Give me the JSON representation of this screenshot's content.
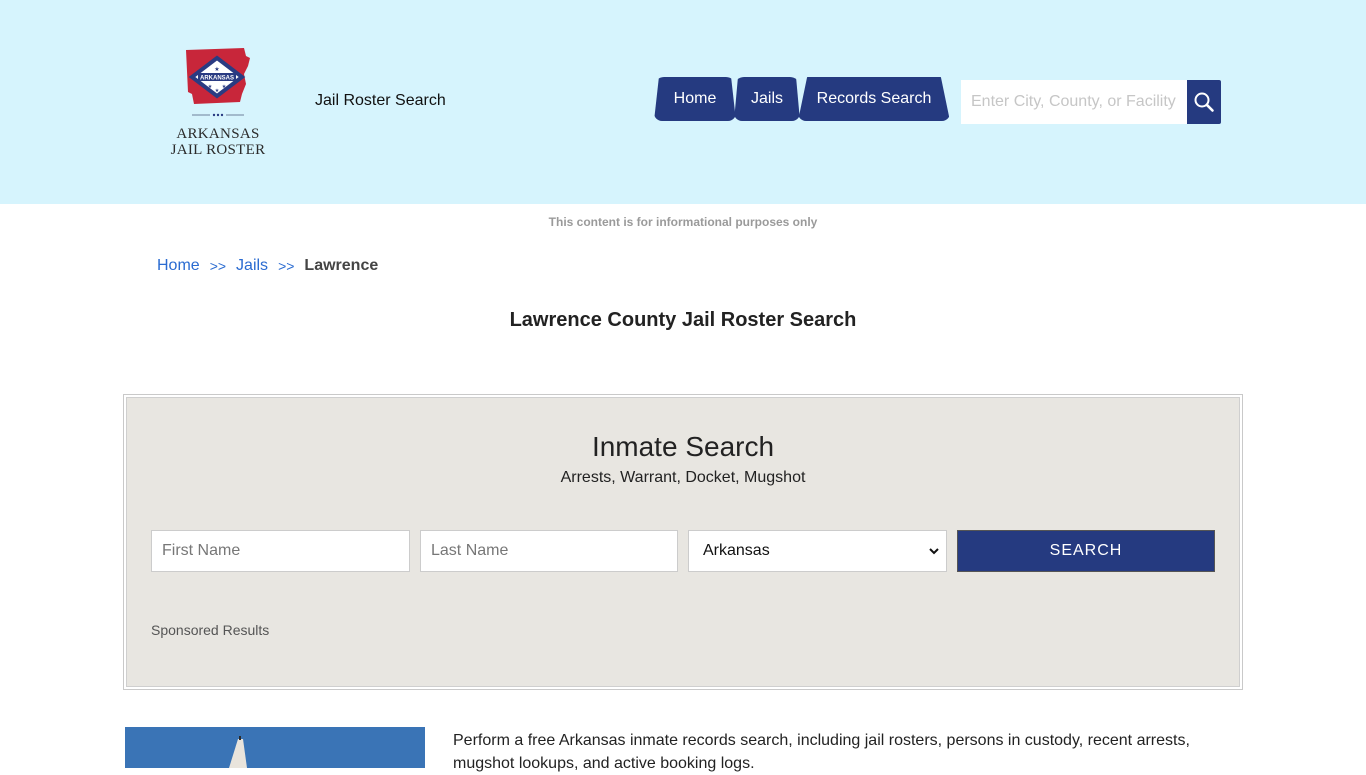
{
  "header": {
    "logo": {
      "state_badge": "ARKANSAS",
      "line1": "ARKANSAS",
      "line2": "JAIL ROSTER"
    },
    "tagline": "Jail Roster Search",
    "nav": [
      {
        "label": "Home"
      },
      {
        "label": "Jails"
      },
      {
        "label": "Records Search"
      }
    ],
    "search": {
      "placeholder": "Enter City, County, or Facility",
      "value": "",
      "icon": "search-icon"
    }
  },
  "disclaimer": "This content is for informational purposes only",
  "breadcrumb": {
    "items": [
      {
        "label": "Home"
      },
      {
        "label": "Jails"
      },
      {
        "label": "Lawrence"
      }
    ],
    "separator": ">>"
  },
  "page_title": "Lawrence County Jail Roster Search",
  "inmate_search": {
    "title": "Inmate Search",
    "subtitle": "Arrests, Warrant, Docket, Mugshot",
    "first_name": {
      "placeholder": "First Name",
      "value": ""
    },
    "last_name": {
      "placeholder": "Last Name",
      "value": ""
    },
    "state": {
      "selected": "Arkansas"
    },
    "button_label": "SEARCH",
    "sponsored": "Sponsored Results"
  },
  "intro": {
    "text": "Perform a free Arkansas inmate records search, including jail rosters, persons in custody, recent arrests, mugshot lookups, and active booking logs."
  },
  "colors": {
    "header_bg": "#d6f4fd",
    "brand_navy": "#253a80",
    "link_blue": "#2a6bd1",
    "panel_bg": "#e8e6e1"
  }
}
